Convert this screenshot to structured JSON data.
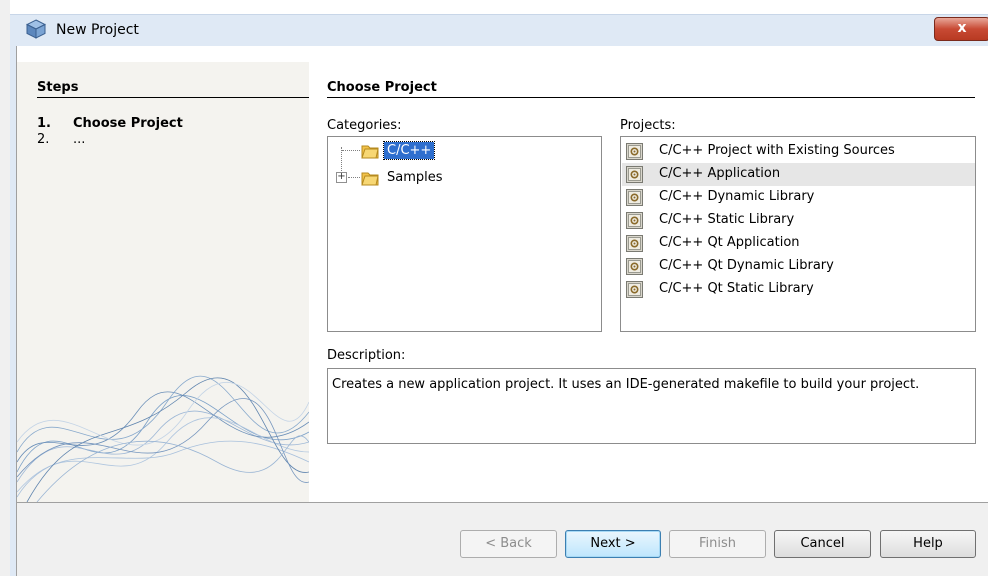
{
  "window": {
    "title": "New Project",
    "close_glyph": "x"
  },
  "steps": {
    "heading": "Steps",
    "items": [
      {
        "num": "1.",
        "label": "Choose Project"
      },
      {
        "num": "2.",
        "label": "..."
      }
    ]
  },
  "main": {
    "heading": "Choose Project",
    "categories_label": "Categories:",
    "projects_label": "Projects:",
    "description_label": "Description:",
    "categories": [
      {
        "label": "C/C++",
        "selected": true,
        "expandable": false,
        "icon": "folder-icon"
      },
      {
        "label": "Samples",
        "selected": false,
        "expandable": true,
        "icon": "folder-icon"
      }
    ],
    "projects": [
      {
        "label": "C/C++ Project with Existing Sources",
        "icon": "project-gear-icon"
      },
      {
        "label": "C/C++ Application",
        "icon": "project-gear-icon",
        "highlighted": true
      },
      {
        "label": "C/C++ Dynamic Library",
        "icon": "project-gear-icon"
      },
      {
        "label": "C/C++ Static Library",
        "icon": "project-gear-icon"
      },
      {
        "label": "C/C++ Qt Application",
        "icon": "project-gear-icon"
      },
      {
        "label": "C/C++ Qt Dynamic Library",
        "icon": "project-gear-icon"
      },
      {
        "label": "C/C++ Qt Static Library",
        "icon": "project-gear-icon"
      }
    ],
    "description": "Creates a new application project. It uses an IDE-generated makefile to build your project."
  },
  "buttons": {
    "back": "< Back",
    "next": "Next >",
    "finish": "Finish",
    "cancel": "Cancel",
    "help": "Help"
  },
  "colors": {
    "selection": "#2f6fce",
    "title_bar": "#dfe9f5",
    "close_button": "#c84a34"
  }
}
